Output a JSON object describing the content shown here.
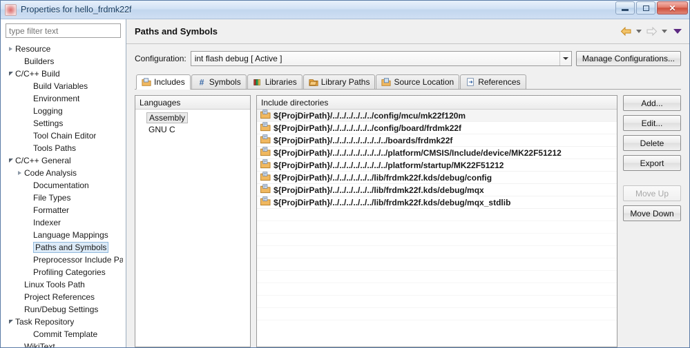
{
  "window": {
    "title": "Properties for hello_frdmk22f",
    "app_icon": "application-icon",
    "controls": {
      "minimize": "minimize-button",
      "restore": "restore-button",
      "close": "close-button",
      "close_glyph": "✕"
    }
  },
  "filter": {
    "placeholder": "type filter text",
    "value": ""
  },
  "tree": [
    {
      "label": "Resource",
      "indent": 0,
      "state": "collapsed"
    },
    {
      "label": "Builders",
      "indent": 1,
      "state": "leaf"
    },
    {
      "label": "C/C++ Build",
      "indent": 0,
      "state": "expanded"
    },
    {
      "label": "Build Variables",
      "indent": 2,
      "state": "leaf"
    },
    {
      "label": "Environment",
      "indent": 2,
      "state": "leaf"
    },
    {
      "label": "Logging",
      "indent": 2,
      "state": "leaf"
    },
    {
      "label": "Settings",
      "indent": 2,
      "state": "leaf"
    },
    {
      "label": "Tool Chain Editor",
      "indent": 2,
      "state": "leaf"
    },
    {
      "label": "Tools Paths",
      "indent": 2,
      "state": "leaf"
    },
    {
      "label": "C/C++ General",
      "indent": 0,
      "state": "expanded"
    },
    {
      "label": "Code Analysis",
      "indent": 1,
      "state": "collapsed"
    },
    {
      "label": "Documentation",
      "indent": 2,
      "state": "leaf"
    },
    {
      "label": "File Types",
      "indent": 2,
      "state": "leaf"
    },
    {
      "label": "Formatter",
      "indent": 2,
      "state": "leaf"
    },
    {
      "label": "Indexer",
      "indent": 2,
      "state": "leaf"
    },
    {
      "label": "Language Mappings",
      "indent": 2,
      "state": "leaf"
    },
    {
      "label": "Paths and Symbols",
      "indent": 2,
      "state": "leaf",
      "selected": true
    },
    {
      "label": "Preprocessor Include Pa",
      "indent": 2,
      "state": "leaf"
    },
    {
      "label": "Profiling Categories",
      "indent": 2,
      "state": "leaf"
    },
    {
      "label": "Linux Tools Path",
      "indent": 1,
      "state": "leaf"
    },
    {
      "label": "Project References",
      "indent": 1,
      "state": "leaf"
    },
    {
      "label": "Run/Debug Settings",
      "indent": 1,
      "state": "leaf"
    },
    {
      "label": "Task Repository",
      "indent": 0,
      "state": "expanded"
    },
    {
      "label": "Commit Template",
      "indent": 2,
      "state": "leaf"
    },
    {
      "label": "WikiText",
      "indent": 1,
      "state": "leaf"
    }
  ],
  "page": {
    "title": "Paths and Symbols",
    "nav": {
      "back": "back-arrow",
      "back_menu": "back-dropdown",
      "forward": "forward-arrow",
      "forward_menu": "forward-dropdown",
      "view_menu": "view-menu-dropdown"
    }
  },
  "configuration": {
    "label": "Configuration:",
    "value": "int flash debug  [ Active ]",
    "manage_label": "Manage Configurations..."
  },
  "tabs": [
    {
      "label": "Includes",
      "icon": "includes-icon",
      "active": true
    },
    {
      "label": "Symbols",
      "icon": "symbols-icon",
      "active": false
    },
    {
      "label": "Libraries",
      "icon": "libraries-icon",
      "active": false
    },
    {
      "label": "Library Paths",
      "icon": "library-paths-icon",
      "active": false
    },
    {
      "label": "Source Location",
      "icon": "source-location-icon",
      "active": false
    },
    {
      "label": "References",
      "icon": "references-icon",
      "active": false
    }
  ],
  "languages": {
    "header": "Languages",
    "items": [
      {
        "label": "Assembly",
        "selected": true
      },
      {
        "label": "GNU C",
        "selected": false
      }
    ]
  },
  "includes": {
    "header": "Include directories",
    "rows": [
      {
        "path": "${ProjDirPath}/../../../../../../config/mcu/mk22f120m",
        "highlighted": true
      },
      {
        "path": "${ProjDirPath}/../../../../../../config/board/frdmk22f",
        "highlighted": false
      },
      {
        "path": "${ProjDirPath}/../../../../../../../../boards/frdmk22f",
        "highlighted": false
      },
      {
        "path": "${ProjDirPath}/../../../../../../../../platform/CMSIS/Include/device/MK22F51212",
        "highlighted": false
      },
      {
        "path": "${ProjDirPath}/../../../../../../../../platform/startup/MK22F51212",
        "highlighted": false
      },
      {
        "path": "${ProjDirPath}/../../../../../../lib/frdmk22f.kds/debug/config",
        "highlighted": false
      },
      {
        "path": "${ProjDirPath}/../../../../../../lib/frdmk22f.kds/debug/mqx",
        "highlighted": false
      },
      {
        "path": "${ProjDirPath}/../../../../../../lib/frdmk22f.kds/debug/mqx_stdlib",
        "highlighted": false
      }
    ]
  },
  "buttons": [
    {
      "label": "Add...",
      "enabled": true
    },
    {
      "label": "Edit...",
      "enabled": true
    },
    {
      "label": "Delete",
      "enabled": true
    },
    {
      "label": "Export",
      "enabled": true
    },
    {
      "label": "Move Up",
      "enabled": false
    },
    {
      "label": "Move Down",
      "enabled": true
    }
  ],
  "colors": {
    "title_text": "#13395e",
    "close_button": "#cf4f3c",
    "selection": "#dceaf7",
    "back_arrow": "#e8a33d",
    "forward_arrow": "#cccccc",
    "view_menu": "#5d2a82",
    "folder_icon": "#e8a33d"
  }
}
